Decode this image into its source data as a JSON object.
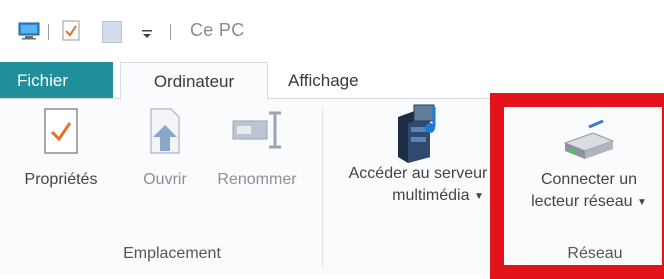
{
  "window": {
    "title": "Ce PC"
  },
  "tabs": {
    "file": "Fichier",
    "computer": "Ordinateur",
    "view": "Affichage"
  },
  "ribbon": {
    "groups": {
      "location": {
        "label": "Emplacement",
        "buttons": {
          "properties": "Propriétés",
          "open": "Ouvrir",
          "rename": "Renommer"
        }
      },
      "media": {
        "line1": "Accéder au serveur",
        "line2": "multimédia"
      },
      "network": {
        "label": "Réseau",
        "line1": "Connecter un",
        "line2": "lecteur réseau"
      }
    }
  },
  "colors": {
    "file_tab": "#1f8f9b",
    "highlight": "#e3121b"
  },
  "icons": [
    "computer-icon",
    "properties-icon",
    "document-icon",
    "dropdown-icon",
    "open-icon",
    "rename-icon",
    "media-server-icon",
    "network-drive-icon"
  ]
}
